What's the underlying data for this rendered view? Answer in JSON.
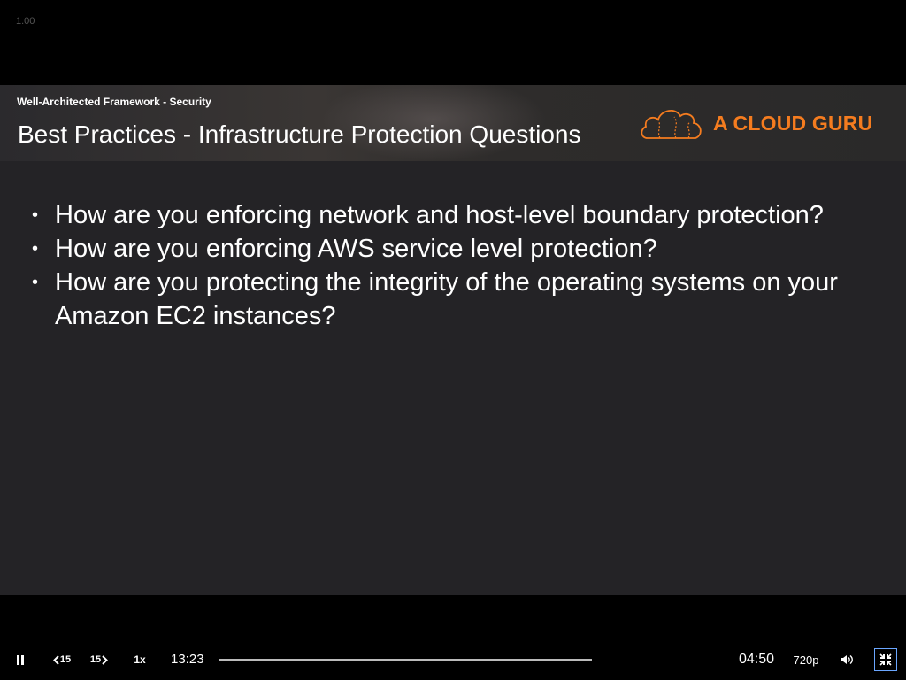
{
  "player": {
    "zoom_readout": "1.00"
  },
  "slide": {
    "course_title": "Well-Architected Framework - Security",
    "title": "Best Practices - Infrastructure Protection Questions",
    "brand": "A CLOUD GURU",
    "brand_color": "#f57c1f",
    "bullets": [
      "How are you enforcing network and host-level boundary protection?",
      "How are you enforcing AWS service level protection?",
      "How are you protecting the integrity of the operating systems on your Amazon EC2 instances?"
    ],
    "bullet_marker": "•"
  },
  "controls": {
    "play_pause_icon": "pause-icon",
    "rewind_label": "15",
    "forward_label": "15",
    "speed_label": "1x",
    "elapsed": "13:23",
    "remaining": "04:50",
    "progress_fraction": 1.0,
    "quality_label": "720p",
    "volume_icon": "volume-icon",
    "exit_fullscreen_icon": "exit-fullscreen-icon"
  }
}
